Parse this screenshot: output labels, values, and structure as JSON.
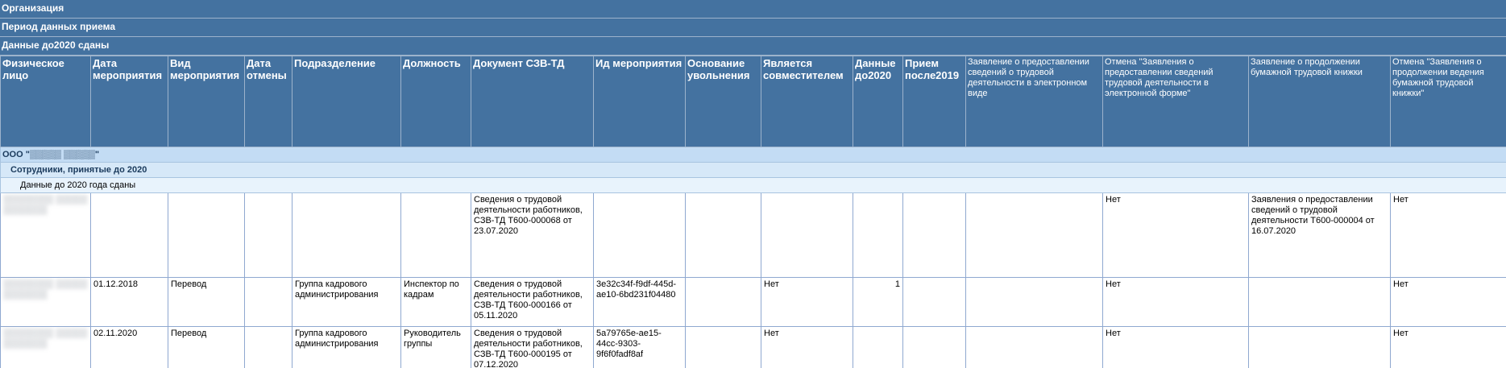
{
  "filters": {
    "organization": "Организация",
    "period": "Период данных приема",
    "data_before": "Данные до2020 сданы"
  },
  "columns": [
    "Физическое лицо",
    "Дата мероприятия",
    "Вид мероприятия",
    "Дата отмены",
    "Подразделение",
    "Должность",
    "Документ СЗВ-ТД",
    "Ид мероприятия",
    "Основание увольнения",
    "Является совместителем",
    "Данные до2020",
    "Прием после2019",
    "Заявление о предоставлении сведений о трудовой деятельности в электронном виде",
    "Отмена \"Заявления о предоставлении сведений трудовой деятельности в электронной форме\"",
    "Заявление о продолжении бумажной трудовой книжки",
    "Отмена \"Заявления о продолжении ведения бумажной трудовой книжки\""
  ],
  "groups": {
    "org": "ООО \"▒▒▒▒▒ ▒▒▒▒▒\"",
    "employees": "Сотрудники, принятые до 2020",
    "data_submitted": "Данные до 2020 года сданы"
  },
  "rows": [
    {
      "person": "▒▒▒▒▒▒▒▒ ▒▒▒▒▒ ▒▒▒▒▒▒▒",
      "date": "",
      "kind": "",
      "cancel_date": "",
      "department": "",
      "position": "",
      "document": "Сведения о трудовой деятельности работников, СЗВ-ТД Т600-000068 от 23.07.2020",
      "event_id": "",
      "dismissal_reason": "",
      "part_time": "",
      "data_before_2020": "",
      "hired_after_2019": "",
      "electronic_app": "",
      "cancel_electronic_app": "Нет",
      "paper_app": "Заявления о предоставлении сведений о трудовой деятельности Т600-000004 от 16.07.2020",
      "cancel_paper_app": "Нет"
    },
    {
      "person": "▒▒▒▒▒▒▒▒ ▒▒▒▒▒ ▒▒▒▒▒▒▒",
      "date": "01.12.2018",
      "kind": "Перевод",
      "cancel_date": "",
      "department": "Группа кадрового администрирования",
      "position": "Инспектор по кадрам",
      "document": "Сведения о трудовой деятельности работников, СЗВ-ТД Т600-000166 от 05.11.2020",
      "event_id": "3e32c34f-f9df-445d-ae10-6bd231f04480",
      "dismissal_reason": "",
      "part_time": "Нет",
      "data_before_2020": "1",
      "hired_after_2019": "",
      "electronic_app": "",
      "cancel_electronic_app": "Нет",
      "paper_app": "",
      "cancel_paper_app": "Нет"
    },
    {
      "person": "▒▒▒▒▒▒▒▒ ▒▒▒▒▒ ▒▒▒▒▒▒▒",
      "date": "02.11.2020",
      "kind": "Перевод",
      "cancel_date": "",
      "department": "Группа кадрового администрирования",
      "position": "Руководитель группы",
      "document": "Сведения о трудовой деятельности работников, СЗВ-ТД Т600-000195 от 07.12.2020",
      "event_id": "5a79765e-ae15-44cc-9303-9f6f0fadf8af",
      "dismissal_reason": "",
      "part_time": "Нет",
      "data_before_2020": "",
      "hired_after_2019": "",
      "electronic_app": "",
      "cancel_electronic_app": "Нет",
      "paper_app": "",
      "cancel_paper_app": "Нет"
    }
  ]
}
